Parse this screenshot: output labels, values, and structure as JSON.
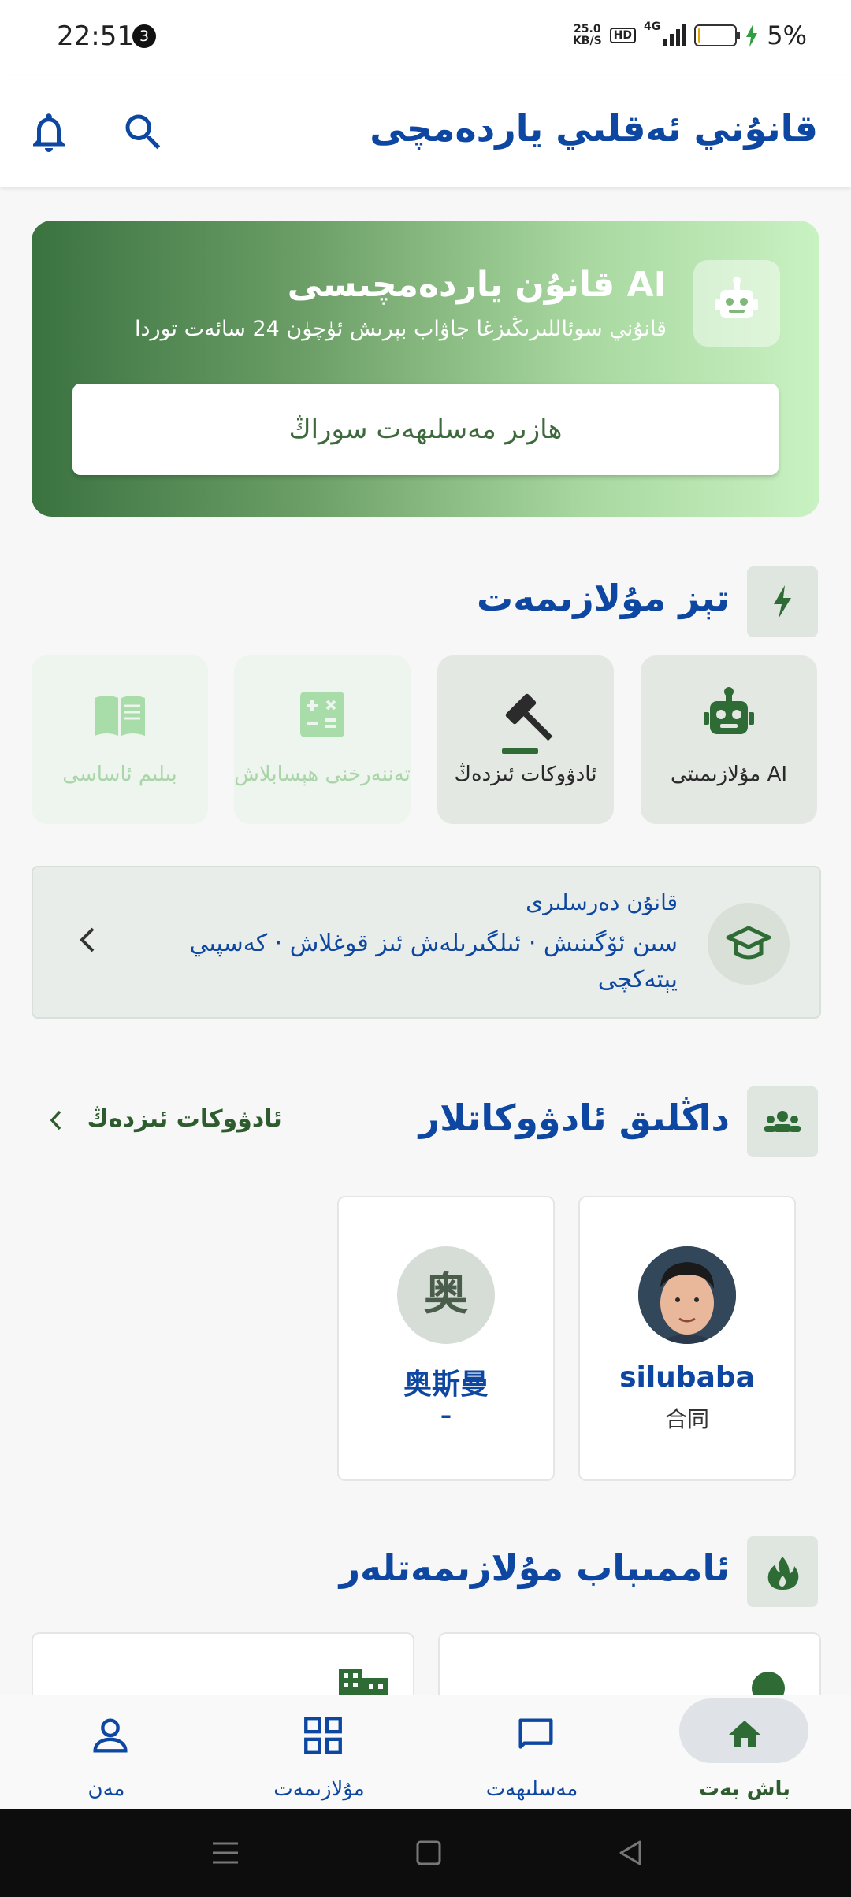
{
  "status_bar": {
    "time": "22:51",
    "notification_count": "3",
    "net_speed_value": "25.0",
    "net_speed_unit": "KB/S",
    "hd": "HD",
    "network_type": "4G",
    "battery_percent": "5%"
  },
  "header": {
    "title": "قانۇني ئەقلىي ياردەمچى",
    "icons": [
      "bell-icon",
      "search-icon"
    ]
  },
  "ai_banner": {
    "title": "AI قانۇن ياردەمچىسى",
    "subtitle": "قانۇني سوئاللىرىڭىزغا جاۋاب بېرىش ئۈچۈن 24 سائەت توردا",
    "button_label": "ھازىر مەسلىھەت سوراڭ"
  },
  "quick_services": {
    "title": "تېز مۇلازىمەت",
    "items": [
      {
        "label": "AI مۇلازىمىتى",
        "icon": "robot-icon",
        "enabled": true
      },
      {
        "label": "ئادۋوكات ئىزدەڭ",
        "icon": "gavel-icon",
        "enabled": true
      },
      {
        "label": "تەننەرخنى ھېسابلاش",
        "icon": "calculator-icon",
        "enabled": false
      },
      {
        "label": "بىلىم ئاساسى",
        "icon": "book-icon",
        "enabled": false
      }
    ]
  },
  "course": {
    "title": "قانۇن دەرسلىرى",
    "description": "سىن ئۆگىنىش · ئىلگىرىلەش ئىز قوغلاش · كەسپىي يېتەكچى"
  },
  "lawyers": {
    "title": "داڭلىق ئادۋوكاتلار",
    "more_label": "ئادۋوكات ئىزدەڭ",
    "items": [
      {
        "name": "silubaba",
        "specialty": "合同",
        "avatar": "photo"
      },
      {
        "name": "奥斯曼",
        "specialty": "–",
        "avatar_char": "奥"
      }
    ]
  },
  "popular": {
    "title": "ئاممىباب مۇلازىمەتلەر"
  },
  "bottom_nav": {
    "items": [
      {
        "label": "باش بەت",
        "icon": "home-icon",
        "active": true
      },
      {
        "label": "مەسلىھەت",
        "icon": "chat-icon",
        "active": false
      },
      {
        "label": "مۇلازىمەت",
        "icon": "grid-icon",
        "active": false
      },
      {
        "label": "مەن",
        "icon": "person-icon",
        "active": false
      }
    ]
  },
  "colors": {
    "primary_blue": "#0d47a1",
    "brand_green": "#3a7240",
    "light_green": "#c9f2c2"
  }
}
